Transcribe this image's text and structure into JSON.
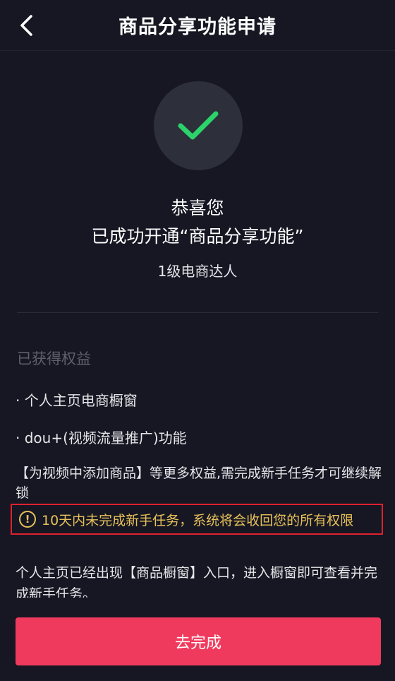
{
  "header": {
    "title": "商品分享功能申请",
    "back_icon": "chevron-left-icon"
  },
  "success": {
    "icon": "check-icon",
    "check_color": "#2bd36a",
    "circle_color": "#2d2f3a",
    "line1": "恭喜您",
    "line2": "已成功开通“商品分享功能”",
    "level": "1级电商达人"
  },
  "benefits": {
    "title": "已获得权益",
    "items": [
      "· 个人主页电商橱窗",
      "· dou+(视频流量推广)功能"
    ],
    "unlock_note": "【为视频中添加商品】等更多权益,需完成新手任务才可继续解锁"
  },
  "warning": {
    "icon": "exclamation-circle-icon",
    "text": "10天内未完成新手任务，系统将会收回您的所有权限",
    "color": "#e8c15a",
    "border_color": "#e0202f"
  },
  "info": {
    "text": "个人主页已经出现【商品橱窗】入口，进入橱窗即可查看并完成新手任务。"
  },
  "action": {
    "label": "去完成",
    "color": "#f03a5d"
  }
}
